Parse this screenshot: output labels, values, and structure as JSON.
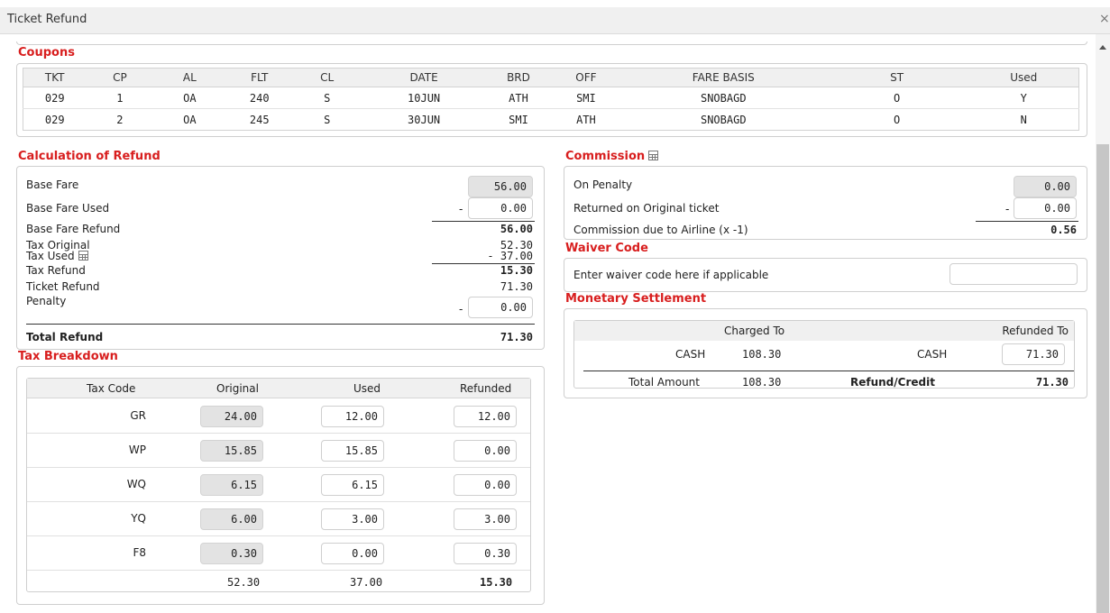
{
  "window": {
    "title": "Ticket Refund",
    "close_glyph": "×"
  },
  "coupons": {
    "title": "Coupons",
    "columns": [
      "TKT",
      "CP",
      "AL",
      "FLT",
      "CL",
      "DATE",
      "BRD",
      "OFF",
      "FARE BASIS",
      "ST",
      "Used"
    ],
    "rows": [
      [
        "029",
        "1",
        "OA",
        "240",
        "S",
        "10JUN",
        "ATH",
        "SMI",
        "SNOBAGD",
        "O",
        "Y"
      ],
      [
        "029",
        "2",
        "OA",
        "245",
        "S",
        "30JUN",
        "SMI",
        "ATH",
        "SNOBAGD",
        "O",
        "N"
      ]
    ]
  },
  "calculation": {
    "title": "Calculation of Refund",
    "base_fare_label": "Base Fare",
    "base_fare_value": "56.00",
    "base_fare_used_label": "Base Fare Used",
    "base_fare_used_value": "0.00",
    "base_fare_refund_label": "Base Fare Refund",
    "base_fare_refund_value": "56.00",
    "tax_original_label": "Tax Original",
    "tax_original_value": "52.30",
    "tax_used_label": "Tax Used",
    "tax_used_value": "- 37.00",
    "tax_refund_label": "Tax Refund",
    "tax_refund_value": "15.30",
    "ticket_refund_label": "Ticket Refund",
    "ticket_refund_value": "71.30",
    "penalty_label": "Penalty",
    "penalty_value": "0.00",
    "total_refund_label": "Total Refund",
    "total_refund_value": "71.30",
    "minus_sign": "-"
  },
  "tax_breakdown": {
    "title": "Tax Breakdown",
    "headers": {
      "code": "Tax Code",
      "original": "Original",
      "used": "Used",
      "refunded": "Refunded"
    },
    "rows": [
      {
        "code": "GR",
        "original": "24.00",
        "used": "12.00",
        "refunded": "12.00"
      },
      {
        "code": "WP",
        "original": "15.85",
        "used": "15.85",
        "refunded": "0.00"
      },
      {
        "code": "WQ",
        "original": "6.15",
        "used": "6.15",
        "refunded": "0.00"
      },
      {
        "code": "YQ",
        "original": "6.00",
        "used": "3.00",
        "refunded": "3.00"
      },
      {
        "code": "F8",
        "original": "0.30",
        "used": "0.00",
        "refunded": "0.30"
      }
    ],
    "totals": {
      "original": "52.30",
      "used": "37.00",
      "refunded": "15.30"
    }
  },
  "commission": {
    "title": "Commission",
    "on_penalty_label": "On Penalty",
    "on_penalty_value": "0.00",
    "returned_label": "Returned on Original ticket",
    "returned_value": "0.00",
    "due_label": "Commission due to Airline (x -1)",
    "due_value": "0.56",
    "minus_sign": "-"
  },
  "waiver": {
    "title": "Waiver Code",
    "label": "Enter waiver code here if applicable",
    "value": ""
  },
  "monetary": {
    "title": "Monetary Settlement",
    "charged_to_label": "Charged To",
    "refunded_to_label": "Refunded To",
    "charged_method": "CASH",
    "charged_amount": "108.30",
    "refunded_method": "CASH",
    "refunded_amount": "71.30",
    "total_label": "Total Amount",
    "total_charged": "108.30",
    "refund_credit_label": "Refund/Credit",
    "total_refunded": "71.30"
  }
}
